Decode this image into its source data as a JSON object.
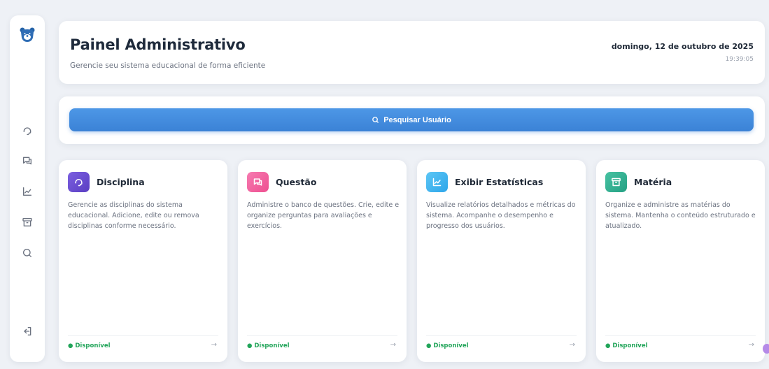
{
  "header": {
    "title": "Painel Administrativo",
    "subtitle": "Gerencie seu sistema educacional de forma eficiente",
    "date": "domingo, 12 de outubro de 2025",
    "time": "19:39:05"
  },
  "search": {
    "button_label": "Pesquisar Usuário"
  },
  "sidebar": {
    "items": [
      {
        "icon": "headset-icon"
      },
      {
        "icon": "chat-icon"
      },
      {
        "icon": "chart-icon"
      },
      {
        "icon": "archive-icon"
      },
      {
        "icon": "search-icon"
      },
      {
        "icon": "logout-icon"
      }
    ]
  },
  "cards": [
    {
      "title": "Disciplina",
      "description": "Gerencie as disciplinas do sistema educacional. Adicione, edite ou remova disciplinas conforme necessário.",
      "status": "● Disponível",
      "arrow": "→",
      "icon": "headset-icon",
      "color": "#6c4fd1"
    },
    {
      "title": "Questão",
      "description": "Administre o banco de questões. Crie, edite e organize perguntas para avaliações e exercícios.",
      "status": "● Disponível",
      "arrow": "→",
      "icon": "chat-icon",
      "color": "#f25c9a"
    },
    {
      "title": "Exibir Estatísticas",
      "description": "Visualize relatórios detalhados e métricas do sistema. Acompanhe o desempenho e progresso dos usuários.",
      "status": "● Disponível",
      "arrow": "→",
      "icon": "chart-icon",
      "color": "#3bb3f0"
    },
    {
      "title": "Matéria",
      "description": "Organize e administre as matérias do sistema. Mantenha o conteúdo estruturado e atualizado.",
      "status": "● Disponível",
      "arrow": "→",
      "icon": "archive-icon",
      "color": "#2fae8f"
    }
  ],
  "colors": {
    "accent": "#3b82d6",
    "status": "#22a55a",
    "background": "#eef1f6"
  }
}
